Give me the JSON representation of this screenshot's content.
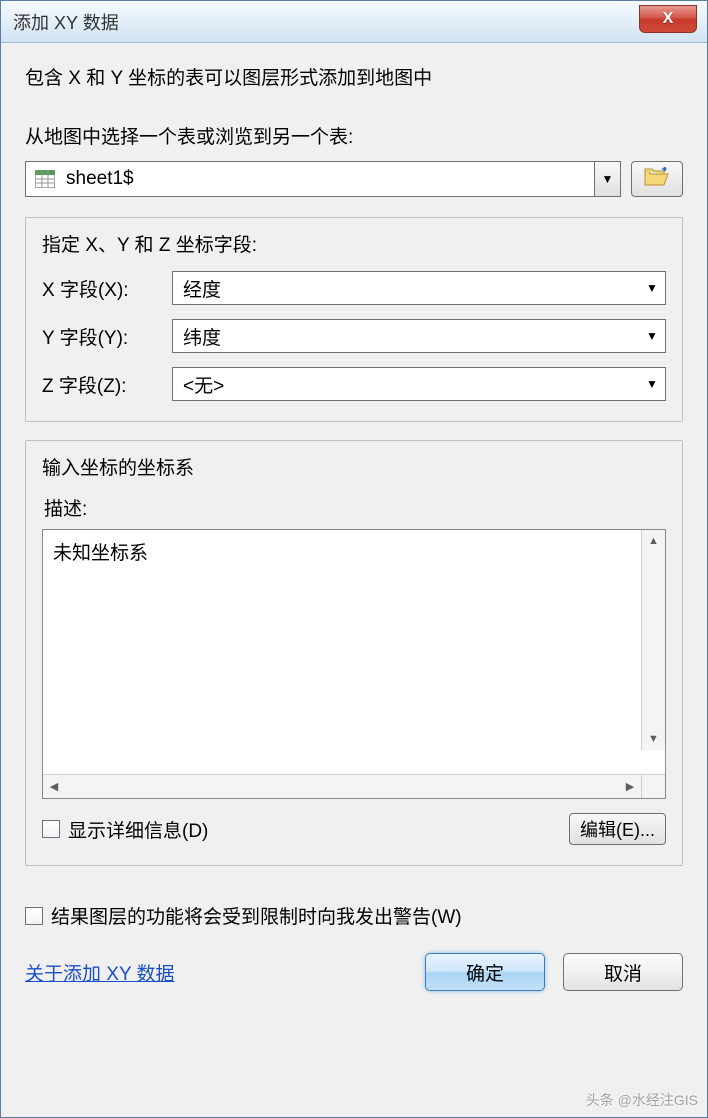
{
  "titlebar": {
    "title": "添加 XY 数据",
    "close_label": "X"
  },
  "intro": "包含 X 和 Y 坐标的表可以图层形式添加到地图中",
  "table_select": {
    "label": "从地图中选择一个表或浏览到另一个表:",
    "value": "sheet1$"
  },
  "fields_group": {
    "legend": "指定 X、Y 和 Z 坐标字段:",
    "x_label": "X 字段(X):",
    "x_value": "经度",
    "y_label": "Y 字段(Y):",
    "y_value": "纬度",
    "z_label": "Z 字段(Z):",
    "z_value": "<无>"
  },
  "coord_group": {
    "legend": "输入坐标的坐标系",
    "desc_label": "描述:",
    "desc_value": "未知坐标系",
    "show_detail_label": "显示详细信息(D)",
    "edit_label": "编辑(E)..."
  },
  "warn_checkbox_label": "结果图层的功能将会受到限制时向我发出警告(W)",
  "about_link": "关于添加 XY 数据",
  "buttons": {
    "ok": "确定",
    "cancel": "取消"
  },
  "watermark": "头条 @水经注GIS"
}
